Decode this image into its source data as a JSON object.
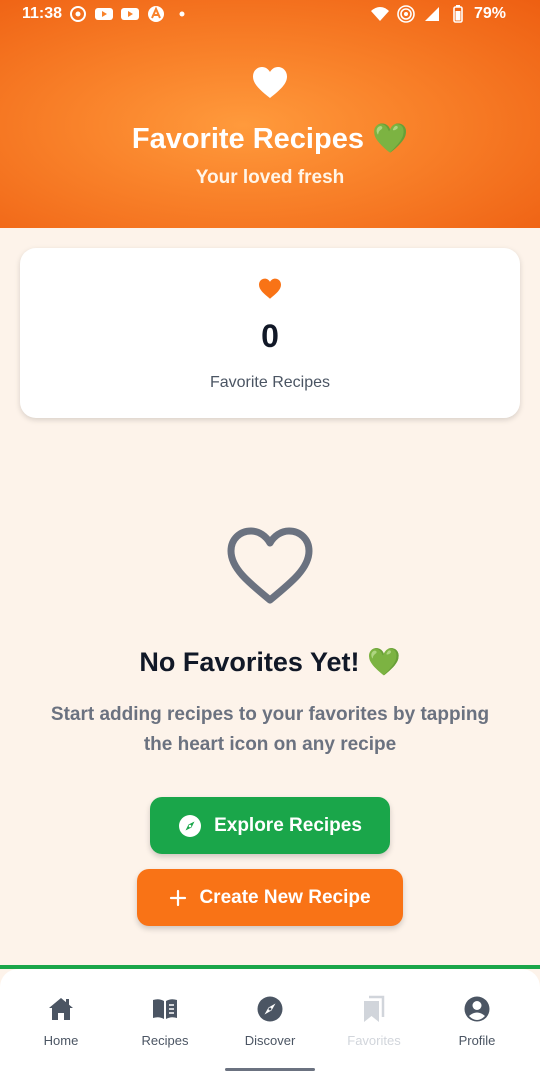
{
  "status_bar": {
    "time": "11:38",
    "battery": "79%",
    "left_icons": [
      "whatsapp-icon",
      "youtube-icon",
      "youtube-icon",
      "app-icon",
      "dot-icon"
    ],
    "right_icons": [
      "wifi-icon",
      "hotspot-icon",
      "signal-icon",
      "battery-icon"
    ]
  },
  "header": {
    "title": "Favorite Recipes 💚",
    "subtitle": "Your loved fresh",
    "icon": "heart-icon"
  },
  "stats_card": {
    "count": "0",
    "label": "Favorite Recipes",
    "icon": "heart-icon"
  },
  "empty_state": {
    "icon": "heart-outline-icon",
    "title": "No Favorites Yet! 💚",
    "message": "Start adding recipes to your favorites by tapping the heart icon on any recipe"
  },
  "buttons": {
    "explore_label": "Explore Recipes",
    "create_label": "Create New Recipe"
  },
  "bottom_nav": {
    "items": [
      {
        "label": "Home",
        "icon": "home-icon"
      },
      {
        "label": "Recipes",
        "icon": "book-icon"
      },
      {
        "label": "Discover",
        "icon": "compass-icon"
      },
      {
        "label": "Favorites",
        "icon": "bookmark-icon"
      },
      {
        "label": "Profile",
        "icon": "person-icon"
      }
    ]
  },
  "colors": {
    "header_gradient": [
      "#ff9a3c",
      "#ee5f12"
    ],
    "accent_orange": "#f97316",
    "accent_green": "#1aa64a",
    "background": "#fdf3ea"
  }
}
